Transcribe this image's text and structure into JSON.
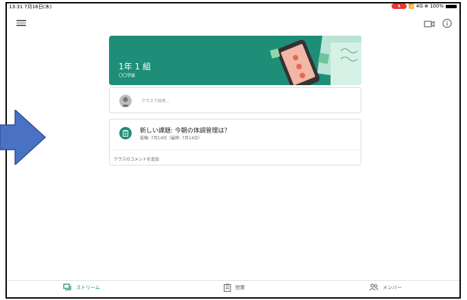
{
  "status_bar": {
    "time_date": "13:31 7月16日(木)",
    "right": "📶 4G ⊕ 100%"
  },
  "header": {
    "menu_icon": "menu-icon",
    "video_icon": "video-icon",
    "info_icon": "info-icon"
  },
  "banner": {
    "class_name": "1年 1 組",
    "subtitle": "〇〇学級",
    "color": "#1e8e78"
  },
  "announce": {
    "placeholder": "クラスで共有..."
  },
  "post": {
    "title": "新しい課題: 今朝の体調管理は？",
    "meta": "投稿: 7月14日（最終: 7月14日）",
    "comment_placeholder": "クラスのコメントを追加"
  },
  "bottom_nav": {
    "items": [
      {
        "label": "ストリーム",
        "icon": "stream-icon",
        "active": true
      },
      {
        "label": "授業",
        "icon": "classwork-icon",
        "active": false
      },
      {
        "label": "メンバー",
        "icon": "people-icon",
        "active": false
      }
    ]
  },
  "colors": {
    "accent": "#1e8e78",
    "arrow": "#4a72c4"
  }
}
